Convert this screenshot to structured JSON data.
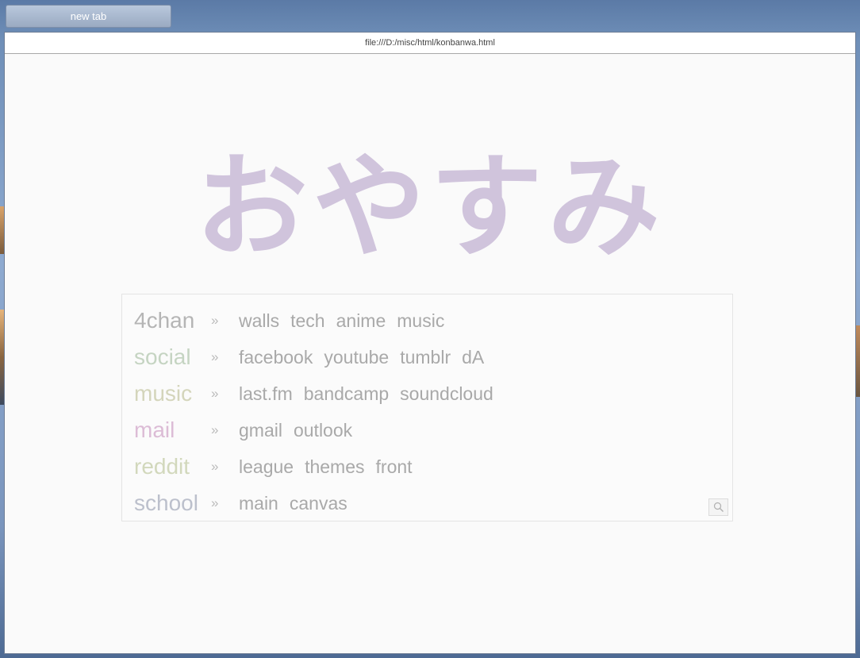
{
  "browser": {
    "tab_label": "new tab",
    "url": "file:///D:/misc/html/konbanwa.html"
  },
  "page": {
    "greeting": "おやすみ",
    "search_icon": "search-icon",
    "colors": {
      "greeting": "#d0c4dc",
      "4chan": "#b5b5b5",
      "social": "#c5d4c2",
      "music": "#d4d5bb",
      "mail": "#dcbcd6",
      "reddit": "#d2d8bc",
      "school": "#bcc0cc"
    },
    "rows": [
      {
        "category": "4chan",
        "separator": "»",
        "links": [
          "walls",
          "tech",
          "anime",
          "music"
        ]
      },
      {
        "category": "social",
        "separator": "»",
        "links": [
          "facebook",
          "youtube",
          "tumblr",
          "dA"
        ]
      },
      {
        "category": "music",
        "separator": "»",
        "links": [
          "last.fm",
          "bandcamp",
          "soundcloud"
        ]
      },
      {
        "category": "mail",
        "separator": "»",
        "links": [
          "gmail",
          "outlook"
        ]
      },
      {
        "category": "reddit",
        "separator": "»",
        "links": [
          "league",
          "themes",
          "front"
        ]
      },
      {
        "category": "school",
        "separator": "»",
        "links": [
          "main",
          "canvas"
        ]
      }
    ]
  }
}
